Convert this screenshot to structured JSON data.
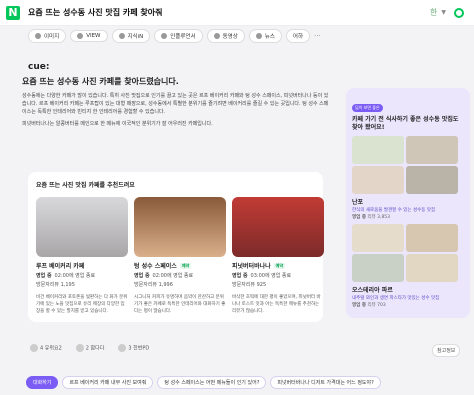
{
  "search": {
    "query": "요즘 뜨는 성수동 사진 맛집 카페 찾아줘",
    "kbd": "한"
  },
  "tabs": [
    {
      "label": "이미지"
    },
    {
      "label": "VIEW"
    },
    {
      "label": "지식iN"
    },
    {
      "label": "인플루언서"
    },
    {
      "label": "동영상"
    },
    {
      "label": "뉴스"
    },
    {
      "label": "어하"
    }
  ],
  "cue_logo": "cue:",
  "main": {
    "heading": "요즘 뜨는 성수동 사진 카페를 찾아드렸습니다.",
    "para1": "성수동에는 다양한 카페가 많이 있습니다. 특히 사진 맛집으로 인기를 끌고 있는 곳은 르프 베이커리 카페와 텅 성수 스페이스, 피넛버터나나 등이 있습니다. 르프 베이커리 카페는 루프탑이 있는 대형 매장으로, 성수동에서 특별한 분위기를 즐기려면 베이커리를 즐길 수 있는 곳입니다. 텅 성수 스페이스는 독특한 인테리어와 빈티지 한 인테리어를 경험할 수 있습니다.",
    "para2": "피넛버터나나는 알콩버터를 메인으로 한 메뉴에 이국적인 분위기가 잘 어우러진 카페입니다.",
    "rec_title": "요즘 뜨는 사진 맛집 카페를 추천드려요",
    "cards": [
      {
        "name": "루프 베이커리 카페",
        "badge": "",
        "hours_label": "영업 중",
        "hours": "02:00에 영업 종료",
        "reviews": "방문자리뷰 1,195",
        "desc": "비건 베이커리와 포토존을 빛판하는 다 화가 분위기에 있는 노을 맛집으로 유리 매장의 다양한 입장을 할 수 있는 필지를 받고 있습니다."
      },
      {
        "name": "텅 성수 스페이스",
        "badge": "예약",
        "hours_label": "영업 중",
        "hours": "02:00에 영업 종료",
        "reviews": "방문자리뷰 1,996",
        "desc": "시그니처 커피가 유명하며 음악이 잔잔하고 분위기가 좋은 카페로 독특한 인테리어와 대화하기 좋다는 평이 많습니다."
      },
      {
        "name": "피넛버터바나나",
        "badge": "예약",
        "hours_label": "영업 중",
        "hours": "03:00에 영업 종료",
        "reviews": "방문자리뷰 925",
        "desc": "바삭한 호떡에 대한 평이 좋았으며, 피넛버터 바나나 토스트 맛과 아는 독특한 메뉴를 추천하는 리뷰가 많습니다."
      }
    ]
  },
  "reactions": [
    {
      "label": "유위요2",
      "count": "4"
    },
    {
      "label": "합다다",
      "count": "2"
    },
    {
      "label": "한번PD",
      "count": "3"
    }
  ],
  "ref_button": "참고정보",
  "bottom_pills": [
    {
      "label": "대화하기",
      "active": true
    },
    {
      "label": "르프 베이커리 카페 내부 사진 보여줘"
    },
    {
      "label": "텅 성수 스페이스는 어떤 메뉴들이 인기 있어?"
    },
    {
      "label": "피넛버터바나나 디저트 가격대는 어느 정도야?"
    }
  ],
  "side": {
    "badge": "딥이 보면 좋은",
    "title": "카페 가기 전 식사하기 좋은 성수동 맛집도 찾아 봤어요!",
    "places": [
      {
        "name": "난포",
        "sub": "한식의 새로움을 발견할 수 있는 성수동 맛집",
        "hours_label": "영업 중",
        "reviews": "리뷰 3,853"
      },
      {
        "name": "오스테리아 파르",
        "sub": "내추럴 와인과 생면 파스타가 맛있는 성수 맛집",
        "hours_label": "영업 중",
        "reviews": "리뷰 703"
      }
    ]
  }
}
